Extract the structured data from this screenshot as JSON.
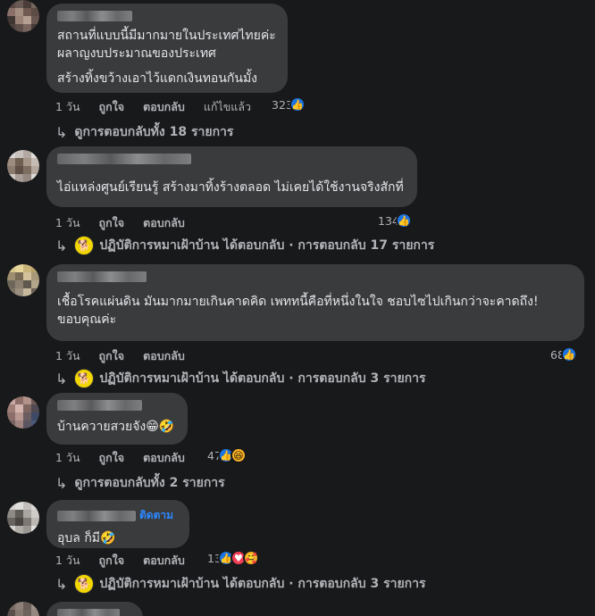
{
  "comments": [
    {
      "lines": [
        "สถานที่แบบนี้มีมากมายในประเทศไทยค่ะ",
        "ผลาญงบประมาณของประเทศ",
        "สร้างทิ้งขว้างเอาไว้แดกเงินทอนกันมั้ง"
      ],
      "actions": {
        "time": "1 วัน",
        "like": "ถูกใจ",
        "reply": "ตอบกลับ",
        "edited": "แก้ไขแล้ว"
      },
      "reaction_count": "323",
      "reply_summary": "ดูการตอบกลับทั้ง 18 รายการ"
    },
    {
      "lines": [
        "ไอ่แหล่งศูนย์เรียนรู้ สร้างมาทิ้งร้างตลอด ไม่เคยได้ใช้งานจริงสักที่"
      ],
      "actions": {
        "time": "1 วัน",
        "like": "ถูกใจ",
        "reply": "ตอบกลับ"
      },
      "reaction_count": "134",
      "reply_summary": "ปฏิบัติการหมาเฝ้าบ้าน ได้ตอบกลับ · การตอบกลับ 17 รายการ"
    },
    {
      "lines": [
        "เชื้อโรคแผ่นดิน มันมากมายเกินคาดคิด เพททนี้คือที่หนึ่งในใจ ชอบไซไปเกินกว่าจะคาดถึง!",
        "ขอบคุณค่ะ"
      ],
      "actions": {
        "time": "1 วัน",
        "like": "ถูกใจ",
        "reply": "ตอบกลับ"
      },
      "reaction_count": "68",
      "reply_summary": "ปฏิบัติการหมาเฝ้าบ้าน ได้ตอบกลับ · การตอบกลับ 3 รายการ"
    },
    {
      "lines": [
        "บ้านควายสวยจัง😁🤣"
      ],
      "actions": {
        "time": "1 วัน",
        "like": "ถูกใจ",
        "reply": "ตอบกลับ"
      },
      "reaction_count": "47",
      "reply_summary": "ดูการตอบกลับทั้ง 2 รายการ"
    },
    {
      "follow": "ติดตาม",
      "lines": [
        "อุบล ก็มี🤣"
      ],
      "actions": {
        "time": "1 วัน",
        "like": "ถูกใจ",
        "reply": "ตอบกลับ"
      },
      "reaction_count": "13",
      "reply_summary": "ปฏิบัติการหมาเฝ้าบ้าน ได้ตอบกลับ · การตอบกลับ 3 รายการ"
    }
  ],
  "colors": {
    "background": "#18191a",
    "bubble": "#3a3b3c",
    "like_blue": "#1b74e4",
    "link_blue": "#2d88ff"
  },
  "icons": {
    "like": "thumbs-up-icon",
    "love": "heart-icon",
    "haha": "laughing-face-icon",
    "care": "care-face-icon",
    "reply_arrow": "reply-arrow-icon",
    "page_avatar": "dog-page-avatar-icon"
  }
}
